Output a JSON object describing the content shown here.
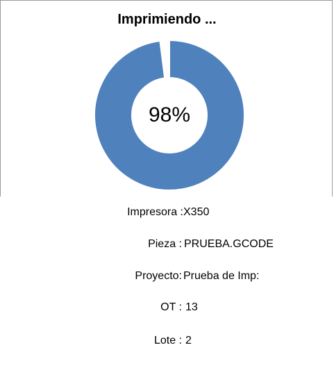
{
  "header": {
    "title": "Imprimiendo ..."
  },
  "chart_data": {
    "type": "donut",
    "title": "Imprimiendo ...",
    "values": [
      98,
      2
    ],
    "center_label": "98%",
    "colors": {
      "progress": "#4F81BD",
      "remaining": "#FFFFFF"
    }
  },
  "details": [
    {
      "label": "Impresora :",
      "value": "X350"
    },
    {
      "label": "Pieza :",
      "value": "PRUEBA.GCODE"
    },
    {
      "label": "Proyecto:",
      "value": "Prueba de Imp:"
    },
    {
      "label": "OT :",
      "value": "13"
    },
    {
      "label": "Lote :",
      "value": "2"
    }
  ]
}
